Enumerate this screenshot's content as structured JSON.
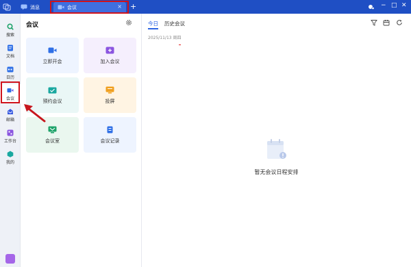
{
  "titlebar": {
    "tabs": [
      {
        "label": "消息",
        "icon": "message-icon"
      },
      {
        "label": "会议",
        "icon": "meeting-icon"
      }
    ],
    "close_glyph": "×",
    "add_glyph": "+",
    "window_controls": {
      "minimize": "−",
      "maximize": "□",
      "close": "✕"
    }
  },
  "sidebar": {
    "items": [
      {
        "label": "搜索",
        "icon": "search-icon",
        "color": "#1fa36a"
      },
      {
        "label": "文档",
        "icon": "doc-icon",
        "color": "#2f6fe6"
      },
      {
        "label": "日历",
        "icon": "calendar-icon",
        "color": "#2f6fe6"
      },
      {
        "label": "会议",
        "icon": "meeting-icon",
        "color": "#2f6fe6"
      },
      {
        "label": "邮箱",
        "icon": "mail-icon",
        "color": "#3a5be0"
      },
      {
        "label": "工作台",
        "icon": "workspace-icon",
        "color": "#8b55e0"
      },
      {
        "label": "我的",
        "icon": "user-icon",
        "color": "#1aa8a0"
      }
    ]
  },
  "panel": {
    "title": "会议",
    "cards": [
      {
        "label": "立即开会",
        "icon": "video-icon",
        "bg": "#eef4ff",
        "icolor": "#2f6fe6"
      },
      {
        "label": "加入会议",
        "icon": "join-icon",
        "bg": "#f5effd",
        "icolor": "#8b55e0"
      },
      {
        "label": "预约会议",
        "icon": "schedule-icon",
        "bg": "#eaf7f6",
        "icolor": "#1aa8a0"
      },
      {
        "label": "投屏",
        "icon": "cast-icon",
        "bg": "#fff4e3",
        "icolor": "#f0a020"
      },
      {
        "label": "会议室",
        "icon": "room-icon",
        "bg": "#eaf7ef",
        "icolor": "#1fa36a"
      },
      {
        "label": "会议记录",
        "icon": "record-icon",
        "bg": "#eef4ff",
        "icolor": "#2f6fe6"
      }
    ]
  },
  "main": {
    "tabs": [
      "今日",
      "历史会议"
    ],
    "date": "2025/11/13 周四",
    "empty_text": "暂无会议日程安排"
  }
}
